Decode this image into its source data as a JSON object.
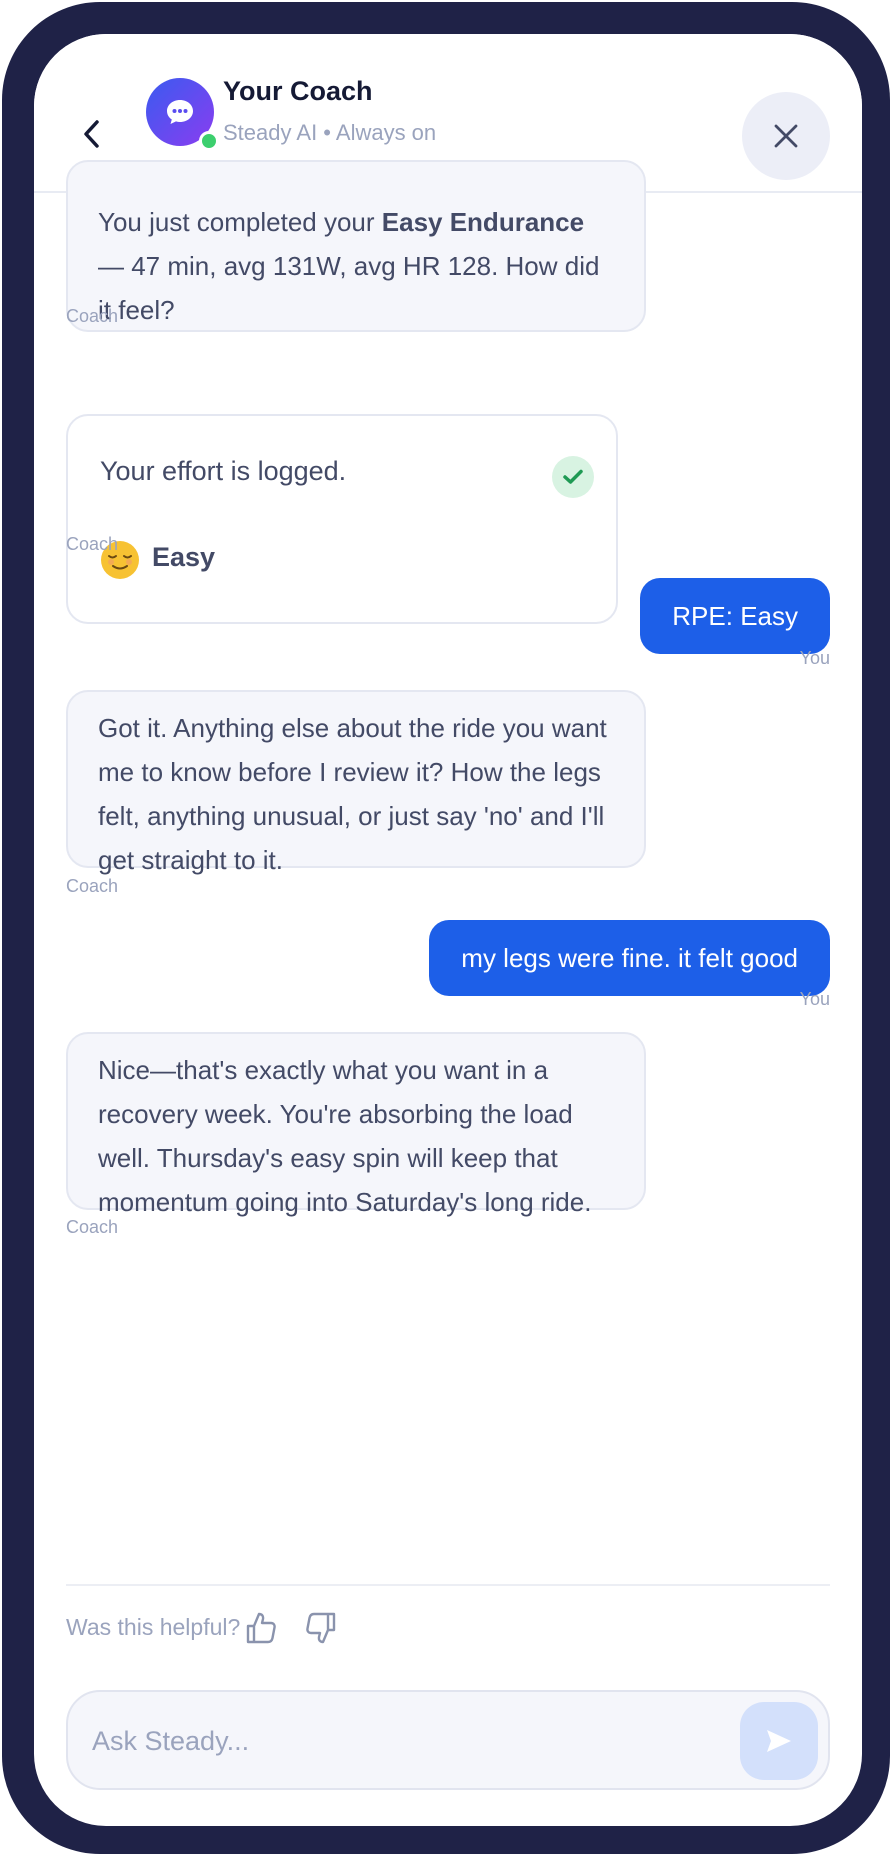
{
  "header": {
    "title": "Your Coach",
    "subtitle": "Steady AI • Always on",
    "back_icon": "chevron-left-icon",
    "close_icon": "close-icon",
    "avatar_icon": "chat-bubble-icon"
  },
  "messages": {
    "m1": {
      "pre": "You just completed your ",
      "bold": "Easy Endurance",
      "post": " — 47 min, avg 131W, avg HR 128. How did it feel?",
      "sender": "Coach"
    },
    "m2": {
      "text": "Your effort is logged.",
      "emoji_icon": "relieved-face-icon",
      "effort": "Easy",
      "sender": "Coach"
    },
    "m3": {
      "text": "RPE: Easy",
      "sender": "You"
    },
    "m4": {
      "text": "Got it. Anything else about the ride you want me to know before I review it? How the legs felt, anything unusual, or just say 'no' and I'll get straight to it.",
      "sender": "Coach"
    },
    "m5": {
      "text": "my legs were fine. it felt good",
      "sender": "You"
    },
    "m6": {
      "text": "Nice—that's exactly what you want in a recovery week. You're absorbing the load well. Thursday's easy spin will keep that momentum going into Saturday's long ride.",
      "sender": "Coach"
    }
  },
  "feedback": {
    "question": "Was this helpful?",
    "up_icon": "thumbs-up-icon",
    "down_icon": "thumbs-down-icon"
  },
  "composer": {
    "placeholder": "Ask Steady...",
    "value": "",
    "send_icon": "send-icon"
  },
  "colors": {
    "frame": "#1f2247",
    "accent": "#1d5fe8",
    "bubble_bg": "#f5f6fb",
    "online": "#3ccf6e",
    "muted_text": "#9aa3bd"
  }
}
